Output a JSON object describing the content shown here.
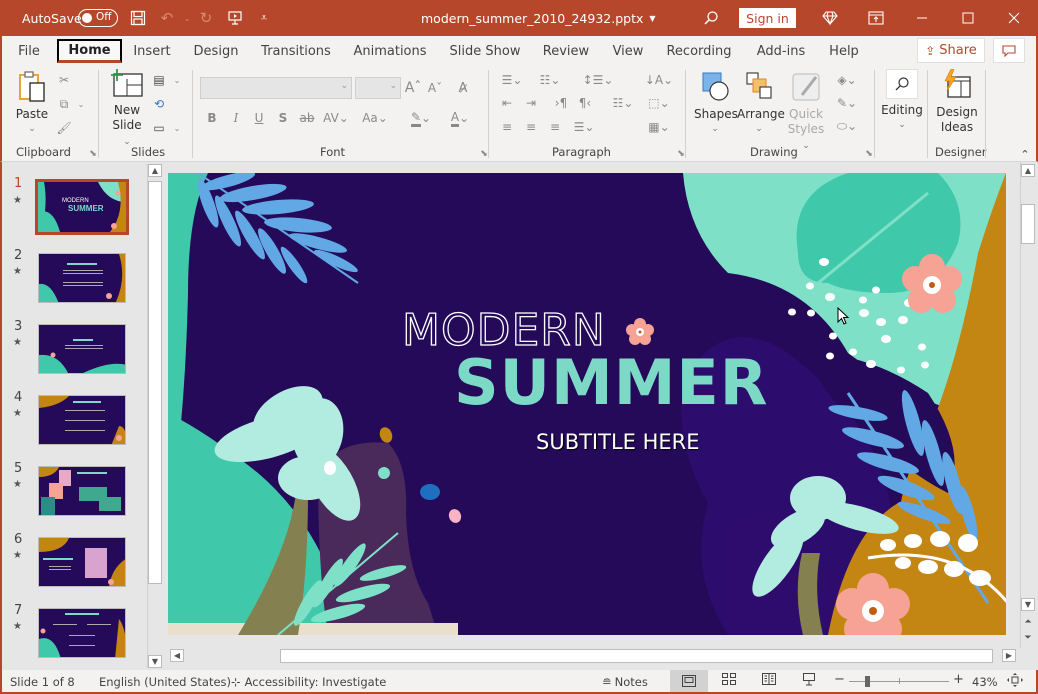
{
  "titlebar": {
    "autosave_label": "AutoSave",
    "autosave_state": "Off",
    "filename": "modern_summer_2010_24932.pptx",
    "signin_label": "Sign in",
    "colors": {
      "brand": "#b7472a"
    }
  },
  "tabs": [
    {
      "label": "File"
    },
    {
      "label": "Home",
      "active": true
    },
    {
      "label": "Insert"
    },
    {
      "label": "Design"
    },
    {
      "label": "Transitions"
    },
    {
      "label": "Animations"
    },
    {
      "label": "Slide Show"
    },
    {
      "label": "Review"
    },
    {
      "label": "View"
    },
    {
      "label": "Recording"
    },
    {
      "label": "Add-ins"
    },
    {
      "label": "Help"
    }
  ],
  "share_label": "Share",
  "ribbon": {
    "clipboard": {
      "label": "Clipboard",
      "paste": "Paste"
    },
    "slides": {
      "label": "Slides",
      "new_slide_1": "New",
      "new_slide_2": "Slide"
    },
    "font": {
      "label": "Font",
      "font_name": "",
      "font_size": ""
    },
    "paragraph": {
      "label": "Paragraph"
    },
    "drawing": {
      "label": "Drawing",
      "shapes": "Shapes",
      "arrange": "Arrange",
      "quick_styles_1": "Quick",
      "quick_styles_2": "Styles"
    },
    "editing": {
      "label": "Editing"
    },
    "designer": {
      "label": "Designer",
      "design_ideas_1": "Design",
      "design_ideas_2": "Ideas"
    }
  },
  "thumbnails": [
    {
      "num": "1",
      "title": "MODERN SUMMER",
      "selected": true
    },
    {
      "num": "2",
      "title": "Your Modern Title"
    },
    {
      "num": "3",
      "title": "YOUR QUOTE"
    },
    {
      "num": "4",
      "title": "Your Modern Title"
    },
    {
      "num": "5",
      "title": "Your Modern Title"
    },
    {
      "num": "6",
      "title": "Your Modern Title"
    },
    {
      "num": "7",
      "title": "Your Modern Title"
    }
  ],
  "slide": {
    "title_line1": "MODERN",
    "title_line2": "SUMMER",
    "subtitle": "SUBTITLE HERE",
    "colors": {
      "background": "#250a5a",
      "teal": "#3fc9aa",
      "mint": "#7fe0c8",
      "mustard": "#c48613",
      "blue_leaf": "#62a8e5",
      "coral": "#f6a294",
      "title_teal": "#7bd9c6"
    }
  },
  "status": {
    "slide_info": "Slide 1 of 8",
    "language": "English (United States)",
    "accessibility": "Accessibility: Investigate",
    "notes": "Notes",
    "zoom": "43%",
    "zoom_fraction": 0.43
  }
}
